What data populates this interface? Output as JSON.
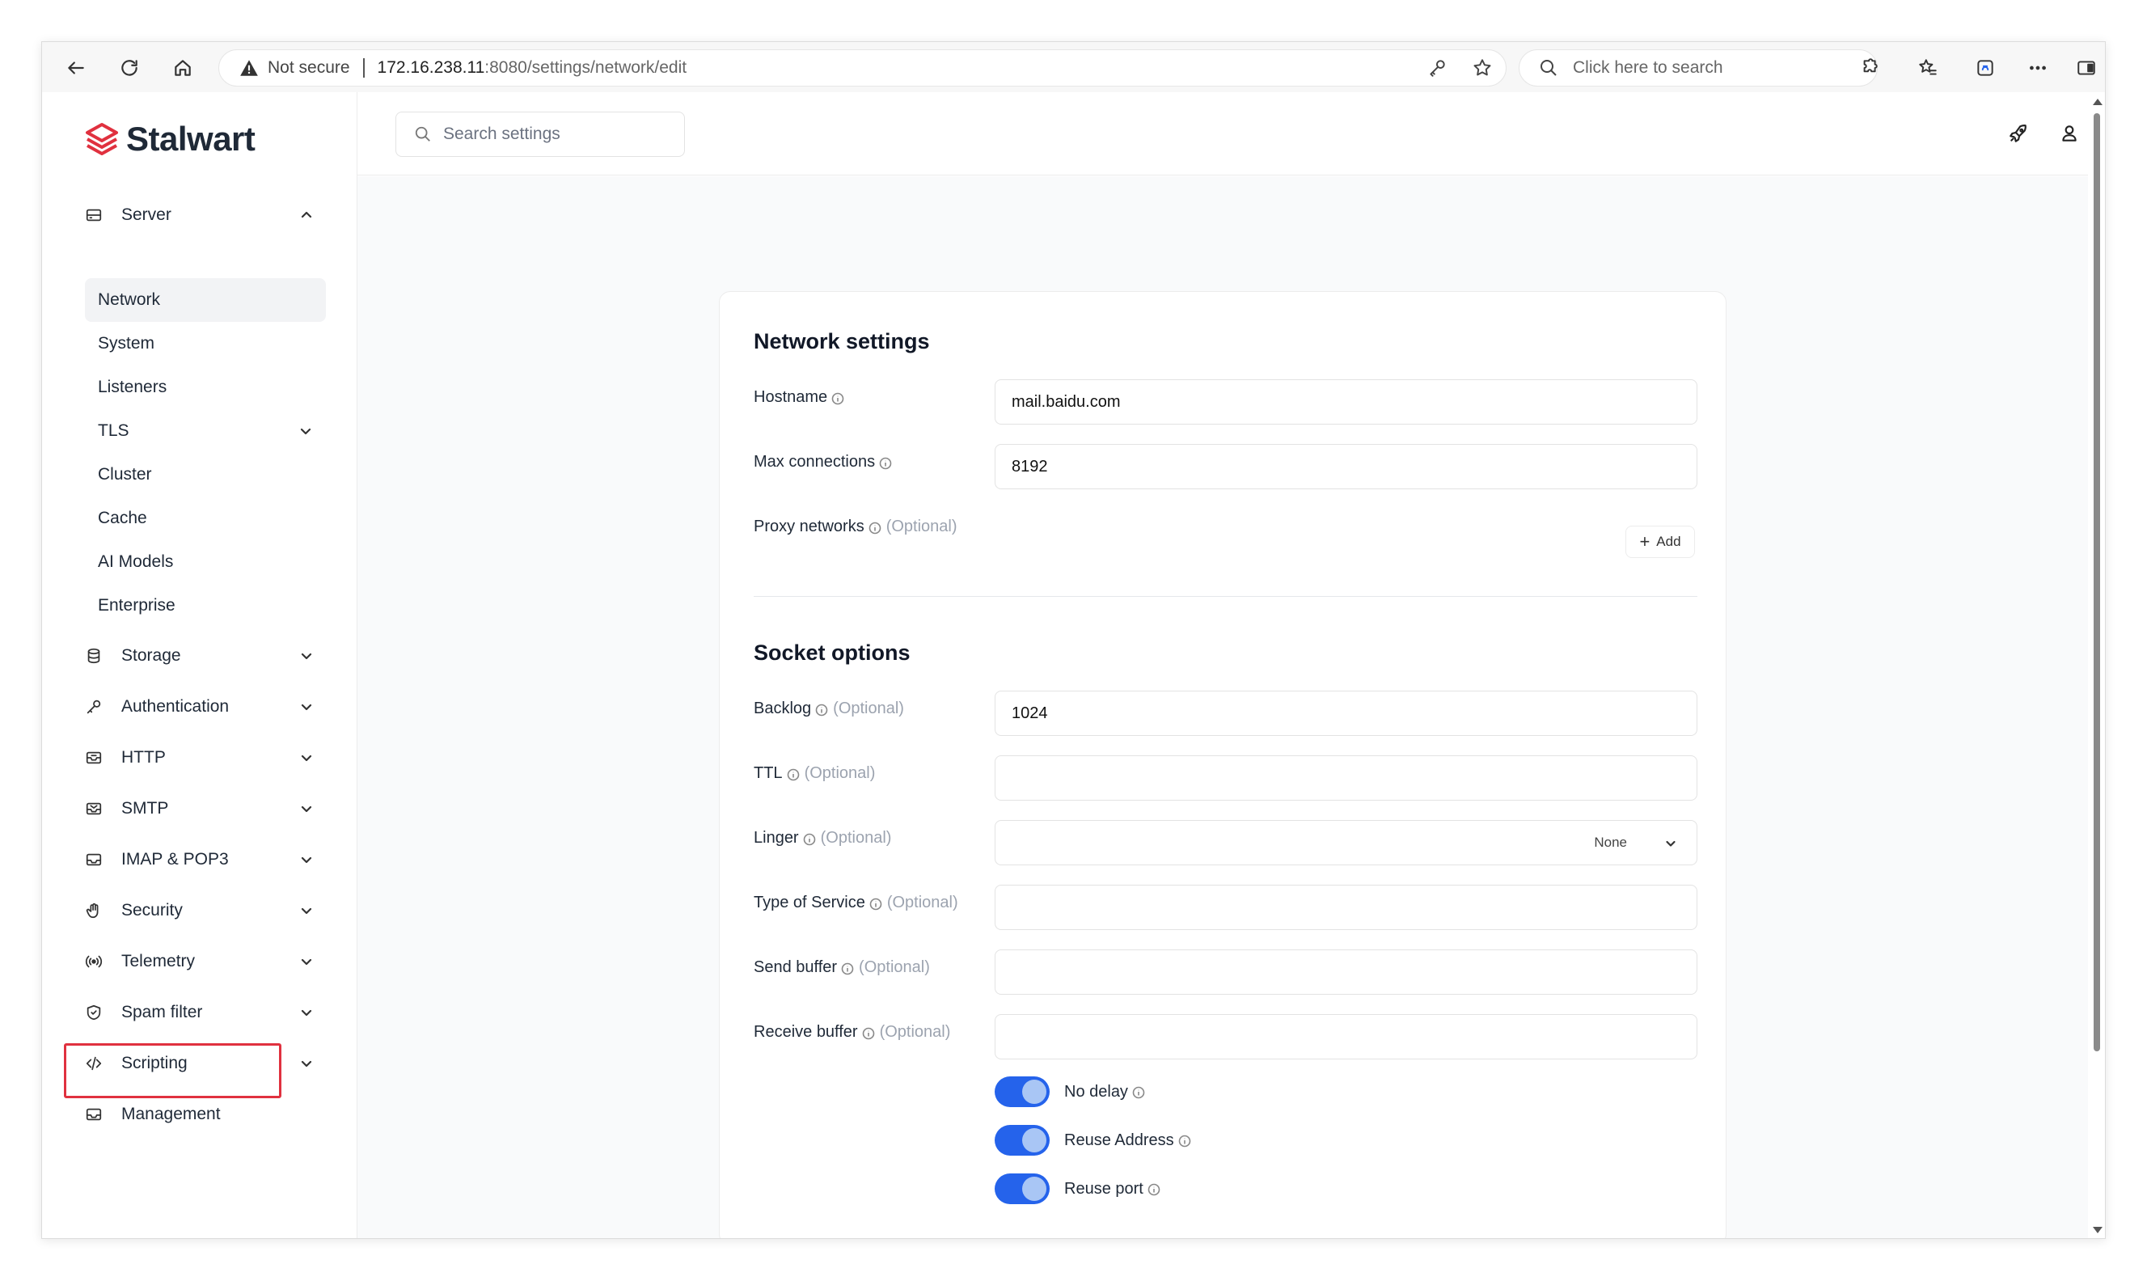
{
  "browser": {
    "security_label": "Not secure",
    "url_host": "172.16.238.11",
    "url_path": ":8080/settings/network/edit",
    "search_placeholder": "Click here to search"
  },
  "sidebar": {
    "brand": "Stalwart",
    "server": {
      "label": "Server",
      "items": [
        {
          "label": "Network"
        },
        {
          "label": "System"
        },
        {
          "label": "Listeners"
        },
        {
          "label": "TLS"
        },
        {
          "label": "Cluster"
        },
        {
          "label": "Cache"
        },
        {
          "label": "AI Models"
        },
        {
          "label": "Enterprise"
        }
      ]
    },
    "sections": [
      {
        "label": "Storage",
        "icon": "database-icon"
      },
      {
        "label": "Authentication",
        "icon": "key-icon"
      },
      {
        "label": "HTTP",
        "icon": "inbox-icon"
      },
      {
        "label": "SMTP",
        "icon": "mail-icon"
      },
      {
        "label": "IMAP & POP3",
        "icon": "tray-icon"
      },
      {
        "label": "Security",
        "icon": "hand-icon"
      },
      {
        "label": "Telemetry",
        "icon": "broadcast-icon"
      },
      {
        "label": "Spam filter",
        "icon": "shield-icon"
      },
      {
        "label": "Scripting",
        "icon": "code-icon"
      }
    ],
    "management": {
      "label": "Management"
    }
  },
  "topbar": {
    "search_placeholder": "Search settings"
  },
  "network_settings": {
    "title": "Network settings",
    "hostname": {
      "label": "Hostname",
      "value": "mail.baidu.com"
    },
    "max_connections": {
      "label": "Max connections",
      "value": "8192"
    },
    "proxy_networks": {
      "label": "Proxy networks",
      "optional": "(Optional)",
      "add_label": "Add"
    }
  },
  "socket_options": {
    "title": "Socket options",
    "backlog": {
      "label": "Backlog",
      "optional": "(Optional)",
      "value": "1024"
    },
    "ttl": {
      "label": "TTL",
      "optional": "(Optional)",
      "value": ""
    },
    "linger": {
      "label": "Linger",
      "optional": "(Optional)",
      "value": "None"
    },
    "tos": {
      "label": "Type of Service",
      "optional": "(Optional)",
      "value": ""
    },
    "send_buffer": {
      "label": "Send buffer",
      "optional": "(Optional)",
      "value": ""
    },
    "receive_buffer": {
      "label": "Receive buffer",
      "optional": "(Optional)",
      "value": ""
    },
    "no_delay": {
      "label": "No delay",
      "enabled": true
    },
    "reuse_address": {
      "label": "Reuse Address",
      "enabled": true
    },
    "reuse_port": {
      "label": "Reuse port",
      "enabled": true
    }
  },
  "colors": {
    "accent": "#2563eb",
    "brand": "#e0313f",
    "highlight": "#e0313f"
  }
}
